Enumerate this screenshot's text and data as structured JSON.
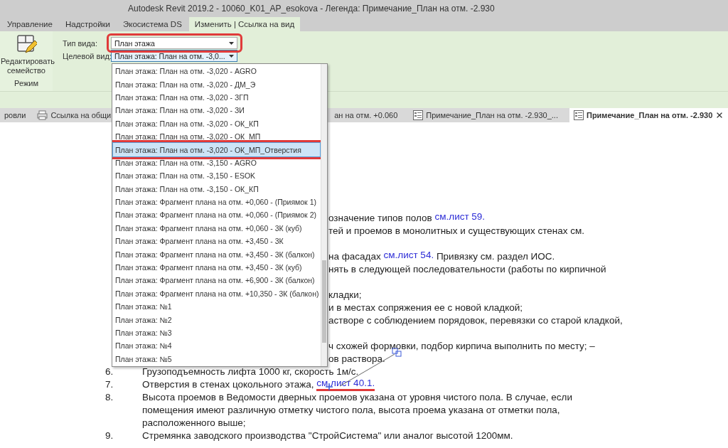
{
  "window": {
    "title": "Autodesk Revit 2019.2 - 10060_K01_AP_esokova - Легенда: Примечание_План на отм. -2.930"
  },
  "ribbon_tabs": [
    {
      "label": "Управление",
      "selected": false
    },
    {
      "label": "Надстройки",
      "selected": false
    },
    {
      "label": "Экосистема DS",
      "selected": false
    },
    {
      "label": "Изменить | Ссылка на вид",
      "selected": true
    }
  ],
  "ribbon": {
    "edit_button": {
      "label": "Редактировать семейство"
    },
    "panel_label": "Режим",
    "view_type": {
      "label": "Тип вида:",
      "value": "План этажа",
      "highlighted": true
    },
    "target_view": {
      "label": "Целевой вид:",
      "value": "План этажа: План на отм. -3,0...",
      "expanded": true
    }
  },
  "view_tabs": [
    {
      "label": "ровли",
      "kind": "plain",
      "selected": false
    },
    {
      "label": "Ссылка на общи",
      "kind": "printer",
      "selected": false
    },
    {
      "label": "ан на отм. +0.060",
      "kind": "covered",
      "selected": false
    },
    {
      "label": "Примечание_План на отм. -2.930_...",
      "kind": "legend",
      "selected": false
    },
    {
      "label": "Примечание_План на отм. -2.930",
      "kind": "legend",
      "selected": true
    }
  ],
  "dropdown": {
    "items": [
      {
        "label": "План этажа: План на отм. -3,020 - AGRO",
        "selected": false,
        "highlighted": false
      },
      {
        "label": "План этажа: План на отм. -3,020 - ДМ_Э",
        "selected": false,
        "highlighted": false
      },
      {
        "label": "План этажа: План на отм. -3,020 - ЗГП",
        "selected": false,
        "highlighted": false
      },
      {
        "label": "План этажа: План на отм. -3,020 - ЗИ",
        "selected": false,
        "highlighted": false
      },
      {
        "label": "План этажа: План на отм. -3,020 - ОК_КП",
        "selected": false,
        "highlighted": false
      },
      {
        "label": "План этажа: План на отм. -3,020 - ОК_МП",
        "selected": false,
        "highlighted": false
      },
      {
        "label": "План этажа: План на отм. -3,020 - ОК_МП_Отверстия",
        "selected": true,
        "highlighted": true
      },
      {
        "label": "План этажа: План на отм. -3,150 - AGRO",
        "selected": false,
        "highlighted": false
      },
      {
        "label": "План этажа: План на отм. -3,150 - ESOK",
        "selected": false,
        "highlighted": false
      },
      {
        "label": "План этажа: План на отм. -3,150 - ОК_КП",
        "selected": false,
        "highlighted": false
      },
      {
        "label": "План этажа: Фрагмент плана на отм. +0,060 - (Приямок 1)",
        "selected": false,
        "highlighted": false
      },
      {
        "label": "План этажа: Фрагмент плана на отм. +0,060 - (Приямок 2)",
        "selected": false,
        "highlighted": false
      },
      {
        "label": "План этажа: Фрагмент плана на отм. +0,060 - 3К (куб)",
        "selected": false,
        "highlighted": false
      },
      {
        "label": "План этажа: Фрагмент плана на отм. +3,450 - 3К",
        "selected": false,
        "highlighted": false
      },
      {
        "label": "План этажа: Фрагмент плана на отм. +3,450 - 3К (балкон)",
        "selected": false,
        "highlighted": false
      },
      {
        "label": "План этажа: Фрагмент плана на отм. +3,450 - 3К (куб)",
        "selected": false,
        "highlighted": false
      },
      {
        "label": "План этажа: Фрагмент плана на отм. +6,900 - 3К (балкон)",
        "selected": false,
        "highlighted": false
      },
      {
        "label": "План этажа: Фрагмент плана на отм. +10,350 - 3К (балкон)",
        "selected": false,
        "highlighted": false
      },
      {
        "label": "План этажа: №1",
        "selected": false,
        "highlighted": false
      },
      {
        "label": "План этажа: №2",
        "selected": false,
        "highlighted": false
      },
      {
        "label": "План этажа: №3",
        "selected": false,
        "highlighted": false
      },
      {
        "label": "План этажа: №4",
        "selected": false,
        "highlighted": false
      },
      {
        "label": "План этажа: №5",
        "selected": false,
        "highlighted": false
      }
    ]
  },
  "document": {
    "lines": [
      {
        "kind": "fragment",
        "parts": [
          {
            "kind": "text",
            "text": "означение типов полов "
          },
          {
            "kind": "link",
            "text": "см.лист 59.",
            "highlighted": false
          }
        ]
      },
      {
        "kind": "fragment",
        "parts": [
          {
            "kind": "text",
            "text": "тей и проемов в монолитных и существующих стенах см."
          }
        ]
      },
      {
        "kind": "covered"
      },
      {
        "kind": "fragment",
        "parts": [
          {
            "kind": "text",
            "text": "на фасадах "
          },
          {
            "kind": "link",
            "text": "см.лист 54.",
            "highlighted": false
          },
          {
            "kind": "text",
            "text": " Привязку см. раздел ИОС."
          }
        ]
      },
      {
        "kind": "fragment",
        "parts": [
          {
            "kind": "text",
            "text": "нять в следующей последовательности (работы по кирпичной"
          }
        ]
      },
      {
        "kind": "covered"
      },
      {
        "kind": "fragment",
        "parts": [
          {
            "kind": "text",
            "text": "кладки;"
          }
        ]
      },
      {
        "kind": "fragment",
        "parts": [
          {
            "kind": "text",
            "text": "и в местах сопряжения ее с новой кладкой;"
          }
        ]
      },
      {
        "kind": "fragment",
        "parts": [
          {
            "kind": "text",
            "text": "астворе с соблюдением порядовок, перевязки со старой кладкой,"
          }
        ]
      },
      {
        "kind": "covered"
      },
      {
        "kind": "fragment",
        "parts": [
          {
            "kind": "text",
            "text": "ч схожей формовки, подбор кирпича выполнить по месту; –"
          }
        ]
      },
      {
        "kind": "fragment",
        "parts": [
          {
            "kind": "text",
            "text": "ов раствора."
          }
        ]
      },
      {
        "kind": "item",
        "number": "6.",
        "parts": [
          {
            "kind": "text",
            "text": "Грузоподъемность лифта 1000 кг, скорость 1м/с."
          }
        ]
      },
      {
        "kind": "item",
        "number": "7.",
        "parts": [
          {
            "kind": "text",
            "text": "Отверстия в стенах цокольного этажа, "
          },
          {
            "kind": "link",
            "text": "см.лист 40.1.",
            "highlighted": true
          }
        ]
      },
      {
        "kind": "item",
        "number": "8.",
        "parts": [
          {
            "kind": "text",
            "text": "Высота проемов в Ведомости дверных проемов указана от уровня чистого пола. В случае, если"
          }
        ]
      },
      {
        "kind": "continuation",
        "parts": [
          {
            "kind": "text",
            "text": "помещения имеют различную отметку чистого пола, высота проема указана от отметки пола,"
          }
        ]
      },
      {
        "kind": "continuation",
        "parts": [
          {
            "kind": "text",
            "text": "расположенного выше;"
          }
        ]
      },
      {
        "kind": "item",
        "number": "9.",
        "parts": [
          {
            "kind": "text",
            "text": "Стремянка заводского производства \"СтройСистема\" или аналог высотой 1200мм."
          }
        ]
      }
    ]
  }
}
